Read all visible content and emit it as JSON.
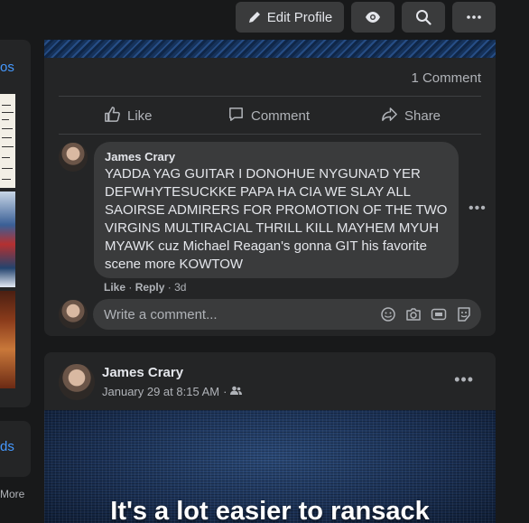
{
  "toolbar": {
    "edit_profile_label": "Edit Profile"
  },
  "left_sidebar": {
    "link_1": "os",
    "link_2": "ds",
    "more": "More"
  },
  "post_1": {
    "comment_count": "1 Comment",
    "actions": {
      "like": "Like",
      "comment": "Comment",
      "share": "Share"
    },
    "comment": {
      "author": "James Crary",
      "text": "YADDA YAG GUITAR I DONOHUE NYGUNA'D YER DEFWHYTESUCKKE PAPA HA CIA WE SLAY ALL SAOIRSE ADMIRERS FOR PROMOTION OF THE TWO VIRGINS MULTIRACIAL THRILL KILL MAYHEM MYUH MYAWK cuz Michael Reagan's gonna GIT his favorite scene more KOWTOW",
      "like_label": "Like",
      "reply_label": "Reply",
      "age": "3d"
    },
    "write_comment": {
      "placeholder": "Write a comment..."
    }
  },
  "post_2": {
    "author": "James Crary",
    "date": "January 29 at 8:15 AM",
    "audience_icon": "friends-icon",
    "image_caption": "It's a lot easier to ransack"
  },
  "colors": {
    "background": "#18191a",
    "card": "#242526",
    "button": "#3a3b3c",
    "link": "#4599ff",
    "secondary_text": "#b0b3b8"
  }
}
